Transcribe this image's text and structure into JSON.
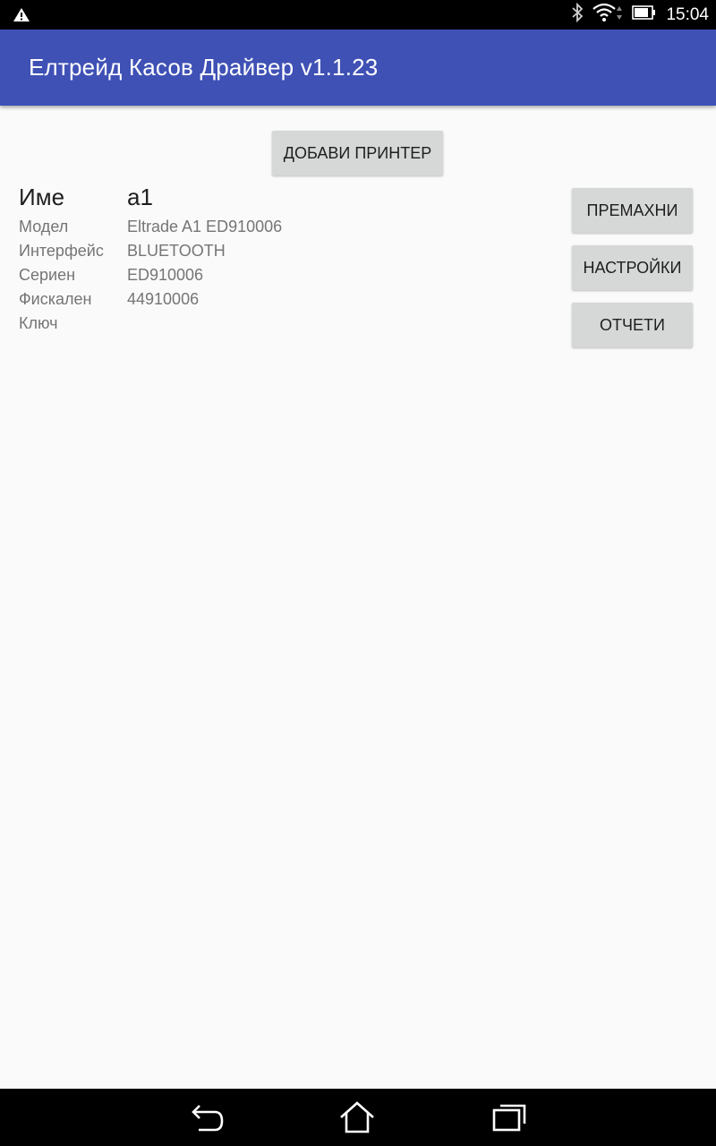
{
  "status_bar": {
    "time": "15:04",
    "icons": [
      "warning-icon",
      "bluetooth-icon",
      "wifi-icon",
      "battery-icon"
    ]
  },
  "app_bar": {
    "title": "Елтрейд Касов Драйвер v1.1.23",
    "color": "#3f51b5"
  },
  "actions": {
    "add_printer": "ДОБАВИ ПРИНТЕР",
    "remove": "ПРЕМАХНИ",
    "settings": "НАСТРОЙКИ",
    "reports": "ОТЧЕТИ"
  },
  "printer": {
    "name_label": "Име",
    "name_value": "a1",
    "fields": [
      {
        "label": "Модел",
        "value": "Eltrade A1 ED910006"
      },
      {
        "label": "Интерфейс",
        "value": "BLUETOOTH"
      },
      {
        "label": "Сериен",
        "value": "ED910006"
      },
      {
        "label": "Фискален",
        "value": "44910006"
      },
      {
        "label": "Ключ",
        "value": ""
      }
    ]
  },
  "nav_bar": {
    "icons": [
      "back-icon",
      "home-icon",
      "recent-apps-icon"
    ]
  }
}
